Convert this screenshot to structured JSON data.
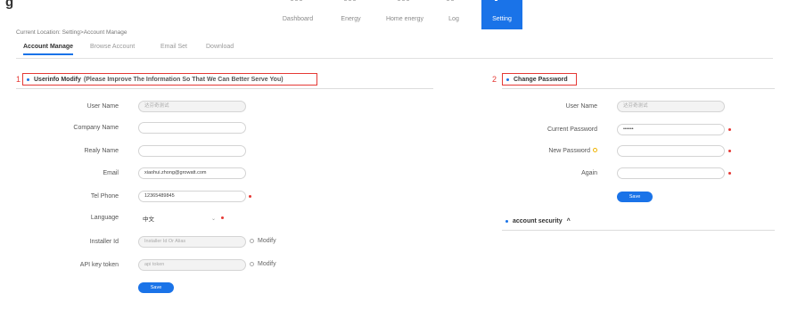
{
  "nav": {
    "items": [
      {
        "label": "Dashboard",
        "active": false
      },
      {
        "label": "Energy",
        "active": false
      },
      {
        "label": "Home energy",
        "active": false
      },
      {
        "label": "Log",
        "active": false
      },
      {
        "label": "Setting",
        "active": true
      }
    ],
    "accent": "#1a73e8"
  },
  "breadcrumb": "Current Location: Setting>Account Manage",
  "tabs": [
    "Account Manage",
    "Browse Account",
    "Email Set",
    "Download"
  ],
  "userinfo": {
    "marker": "1",
    "title": "Userinfo Modify",
    "subtitle": "(Please Improve The Information So That We Can Better Serve You)",
    "fields": {
      "user_name": {
        "label": "User Name",
        "value": "达芬奇测试"
      },
      "company_name": {
        "label": "Company Name",
        "value": ""
      },
      "realy_name": {
        "label": "Realy Name",
        "value": ""
      },
      "email": {
        "label": "Email",
        "value": "xiaohui.zhong@growatt.com"
      },
      "tel_phone": {
        "label": "Tel Phone",
        "value": "12365489845"
      },
      "language": {
        "label": "Language",
        "value": "中文"
      },
      "installer_id": {
        "label": "Installer Id",
        "placeholder": "Installer Id Or Alias",
        "action": "Modify"
      },
      "api_key_token": {
        "label": "API key token",
        "placeholder": "api token",
        "action": "Modify"
      }
    },
    "save_label": "Save"
  },
  "password": {
    "marker": "2",
    "title": "Change Password",
    "fields": {
      "user_name": {
        "label": "User Name",
        "value": "达芬奇测试"
      },
      "current_password": {
        "label": "Current Password",
        "value": "••••••"
      },
      "new_password": {
        "label": "New Password",
        "value": ""
      },
      "again": {
        "label": "Again",
        "value": ""
      }
    },
    "save_label": "Save"
  },
  "account_security": {
    "label": "account security",
    "chevron": "^"
  },
  "colors": {
    "accent": "#1a73e8",
    "required": "#e53935",
    "highlight": "#e53935"
  }
}
